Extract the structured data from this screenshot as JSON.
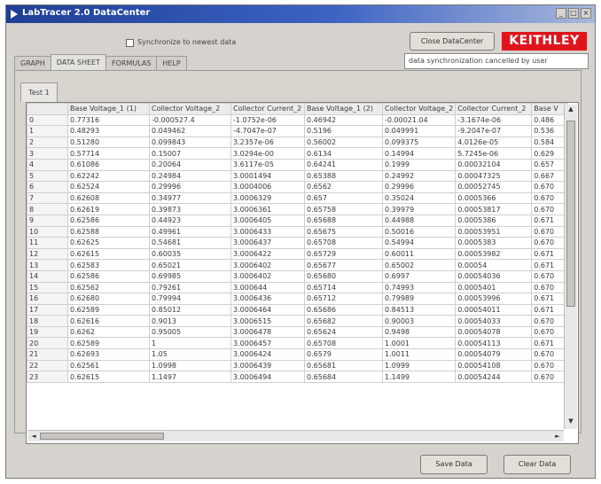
{
  "window": {
    "title": "LabTracer 2.0 DataCenter",
    "controls": [
      "_",
      "□",
      "×"
    ]
  },
  "sync": {
    "label": "Synchronize to newest data",
    "checked": false
  },
  "close_button": "Close DataCenter",
  "logo": "KEITHLEY",
  "status": "data synchronization cancelled by user",
  "tabs": [
    "GRAPH",
    "DATA SHEET",
    "FORMULAS",
    "HELP"
  ],
  "active_tab": "DATA SHEET",
  "subtab": "Test 1",
  "table": {
    "headers": [
      "",
      "Base Voltage_1 (1)",
      "Collector Voltage_2",
      "Collector Current_2",
      "Base Voltage_1 (2)",
      "Collector Voltage_2",
      "Collector Current_2",
      "Base V"
    ],
    "rows": [
      [
        "0",
        "0.77316",
        "-0.000527.4",
        "-1.0752e-06",
        "0.46942",
        "-0.00021.04",
        "-3.1674e-06",
        "0.486"
      ],
      [
        "1",
        "0.48293",
        "0.049462",
        "-4.7047e-07",
        "0.5196",
        "0.049991",
        "-9.2047e-07",
        "0.536"
      ],
      [
        "2",
        "0.51280",
        "0.099843",
        "3.2357e-06",
        "0.56002",
        "0.099375",
        "4.0126e-05",
        "0.584"
      ],
      [
        "3",
        "0.57714",
        "0.15007",
        "3.0294e-00",
        "0.6134",
        "0.14994",
        "5.7245e-06",
        "0.629"
      ],
      [
        "4",
        "0.61086",
        "0.20064",
        "3.6117e-05",
        "0.64241",
        "0.1999",
        "0.00032104",
        "0.657"
      ],
      [
        "5",
        "0.62242",
        "0.24984",
        "3.0001494",
        "0.65388",
        "0.24992",
        "0.00047325",
        "0.667"
      ],
      [
        "6",
        "0.62524",
        "0.29996",
        "3.0004006",
        "0.6562",
        "0.29996",
        "0.00052745",
        "0.670"
      ],
      [
        "7",
        "0.62608",
        "0.34977",
        "3.0006329",
        "0.657",
        "0.35024",
        "0.0005366",
        "0.670"
      ],
      [
        "8",
        "0.62619",
        "0.39873",
        "3.0006361",
        "0.65758",
        "0.39979",
        "0.00053817",
        "0.670"
      ],
      [
        "9",
        "0.62586",
        "0.44923",
        "3.0006405",
        "0.65688",
        "0.44988",
        "0.0005386",
        "0.671"
      ],
      [
        "10",
        "0.62588",
        "0.49961",
        "3.0006433",
        "0.65675",
        "0.50016",
        "0.00053951",
        "0.670"
      ],
      [
        "11",
        "0.62625",
        "0.54681",
        "3.0006437",
        "0.65708",
        "0.54994",
        "0.0005383",
        "0.670"
      ],
      [
        "12",
        "0.62615",
        "0.60035",
        "3.0006422",
        "0.65729",
        "0.60011",
        "0.00053982",
        "0.671"
      ],
      [
        "13",
        "0.62583",
        "0.65021",
        "3.0006402",
        "0.65677",
        "0.65002",
        "0.00054",
        "0.671"
      ],
      [
        "14",
        "0.62586",
        "0.69985",
        "3.0006402",
        "0.65680",
        "0.6997",
        "0.00054036",
        "0.670"
      ],
      [
        "15",
        "0.62562",
        "0.79261",
        "3.000644",
        "0.65714",
        "0.74993",
        "0.0005401",
        "0.670"
      ],
      [
        "16",
        "0.62680",
        "0.79994",
        "3.0006436",
        "0.65712",
        "0.79989",
        "0.00053996",
        "0.671"
      ],
      [
        "17",
        "0.62589",
        "0.85012",
        "3.0006464",
        "0.65686",
        "0.84513",
        "0.00054011",
        "0.671"
      ],
      [
        "18",
        "0.62616",
        "0.9013",
        "3.0006515",
        "0.65682",
        "0.90003",
        "0.00054033",
        "0.670"
      ],
      [
        "19",
        "0.6262",
        "0.95005",
        "3.0006478",
        "0.65624",
        "0.9498",
        "0.00054078",
        "0.670"
      ],
      [
        "20",
        "0.62589",
        "1",
        "3.0006457",
        "0.65708",
        "1.0001",
        "0.00054113",
        "0.671"
      ],
      [
        "21",
        "0.62693",
        "1.05",
        "3.0006424",
        "0.6579",
        "1.0011",
        "0.00054079",
        "0.670"
      ],
      [
        "22",
        "0.62561",
        "1.0998",
        "3.0006439",
        "0.65681",
        "1.0999",
        "0.00054108",
        "0.670"
      ],
      [
        "23",
        "0.62615",
        "1.1497",
        "3.0006494",
        "0.65684",
        "1.1499",
        "0.00054244",
        "0.670"
      ]
    ]
  },
  "buttons": {
    "save": "Save Data",
    "clear": "Clear Data"
  },
  "scroll": {
    "up": "▲",
    "down": "▼",
    "left": "◄",
    "right": "►"
  },
  "colors": {
    "titlebar": "#1f3f95",
    "brand_red": "#e0141c",
    "window_bg": "#d6d3ce"
  }
}
